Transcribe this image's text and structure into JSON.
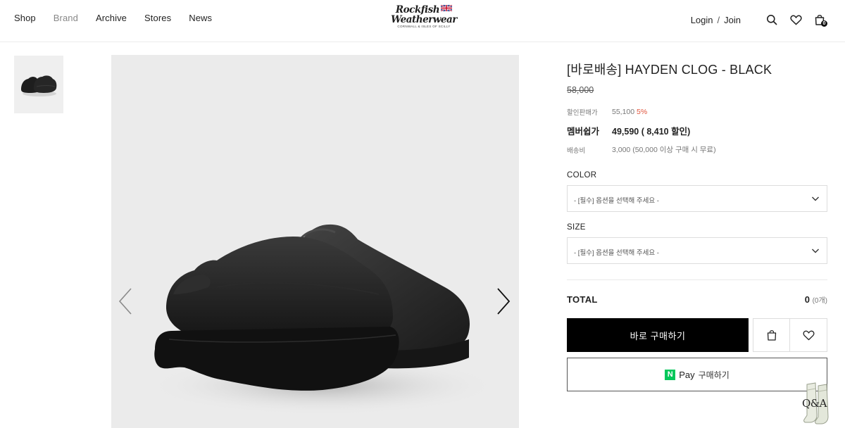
{
  "header": {
    "nav": [
      "Shop",
      "Brand",
      "Archive",
      "Stores",
      "News"
    ],
    "logo": {
      "line1": "Rockfish",
      "line2": "Weatherwear",
      "tagline": "CORNWALL & ISLES OF SCILLY"
    },
    "login": "Login",
    "separator": "/",
    "join": "Join",
    "cart_count": "0"
  },
  "product": {
    "title": "[바로배송] HAYDEN CLOG - BLACK",
    "original_price": "58,000",
    "sale_label": "할인판매가",
    "sale_price": "55,100",
    "sale_discount": "5%",
    "member_label": "멤버쉽가",
    "member_price": "49,590 ( 8,410 할인)",
    "shipping_label": "배송비",
    "shipping_value": "3,000 (50,000 이상 구매 시 무료)",
    "color_label": "COLOR",
    "color_placeholder": "- [필수] 옵션을 선택해 주세요 -",
    "size_label": "SIZE",
    "size_placeholder": "- [필수] 옵션을 선택해 주세요 -",
    "total_label": "TOTAL",
    "total_value": "0",
    "total_count": "(0개)",
    "buy_now": "바로 구매하기",
    "npay_logo": "N",
    "npay_pay": "Pay",
    "npay_buy": "구매하기"
  },
  "floating": {
    "qa_label": "Q&A"
  },
  "colors": {
    "buy_button": "#000000",
    "discount": "#e0543c",
    "naver_green": "#03c75a",
    "image_bg": "#ebebeb"
  },
  "icons": [
    "search-icon",
    "heart-icon",
    "shopping-bag-icon",
    "chevron-left-icon",
    "chevron-right-icon",
    "chevron-down-icon"
  ]
}
